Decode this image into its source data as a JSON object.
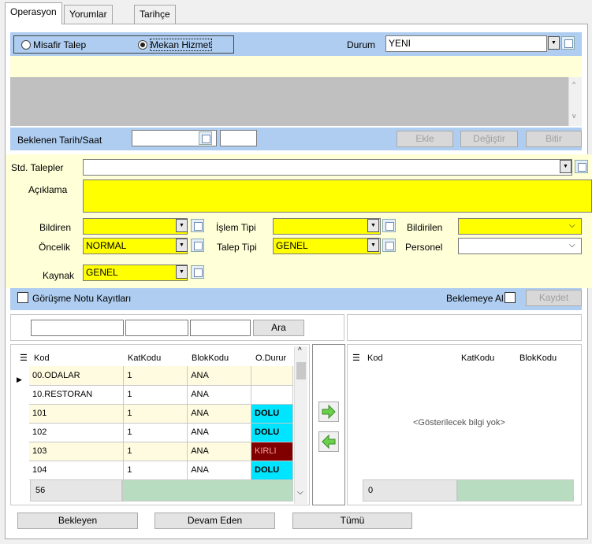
{
  "tabs": [
    "Operasyon",
    "Yorumlar",
    "Tarihçe"
  ],
  "radio": {
    "option1": "Misafir Talep",
    "option2": "Mekan Hizmet",
    "selected": "Mekan Hizmet"
  },
  "durum": {
    "label": "Durum",
    "value": "YENI"
  },
  "beklenen": {
    "label": "Beklenen Tarih/Saat",
    "date": "",
    "time": ""
  },
  "actions": {
    "ekle": "Ekle",
    "degistir": "Değiştir",
    "bitir": "Bitir"
  },
  "form": {
    "std_talepler_label": "Std. Talepler",
    "std_talepler_value": "",
    "aciklama_label": "Açıklama",
    "bildiren_label": "Bildiren",
    "bildiren_value": "",
    "islem_tipi_label": "İşlem Tipi",
    "islem_tipi_value": "",
    "bildirilen_label": "Bildirilen",
    "bildirilen_value": "",
    "oncelik_label": "Öncelik",
    "oncelik_value": "NORMAL",
    "talep_tipi_label": "Talep Tipi",
    "talep_tipi_value": "GENEL",
    "personel_label": "Personel",
    "personel_value": "",
    "kaynak_label": "Kaynak",
    "kaynak_value": "GENEL"
  },
  "gorusme": {
    "label": "Görüşme Notu Kayıtları",
    "beklemeye_label": "Beklemeye Al",
    "kaydet": "Kaydet"
  },
  "search": {
    "button": "Ara"
  },
  "left_grid": {
    "headers": [
      "Kod",
      "KatKodu",
      "BlokKodu",
      "O.Durur"
    ],
    "rows": [
      [
        "00.ODALAR",
        "1",
        "ANA",
        ""
      ],
      [
        "10.RESTORAN",
        "1",
        "ANA",
        ""
      ],
      [
        "101",
        "1",
        "ANA",
        "DOLU"
      ],
      [
        "102",
        "1",
        "ANA",
        "DOLU"
      ],
      [
        "103",
        "1",
        "ANA",
        "KIRLI"
      ],
      [
        "104",
        "1",
        "ANA",
        "DOLU"
      ]
    ],
    "count": "56"
  },
  "right_grid": {
    "headers": [
      "Kod",
      "KatKodu",
      "BlokKodu"
    ],
    "empty": "<Gösterilecek bilgi yok>",
    "count": "0"
  },
  "bottom_buttons": [
    "Bekleyen",
    "Devam Eden",
    "Tümü"
  ]
}
